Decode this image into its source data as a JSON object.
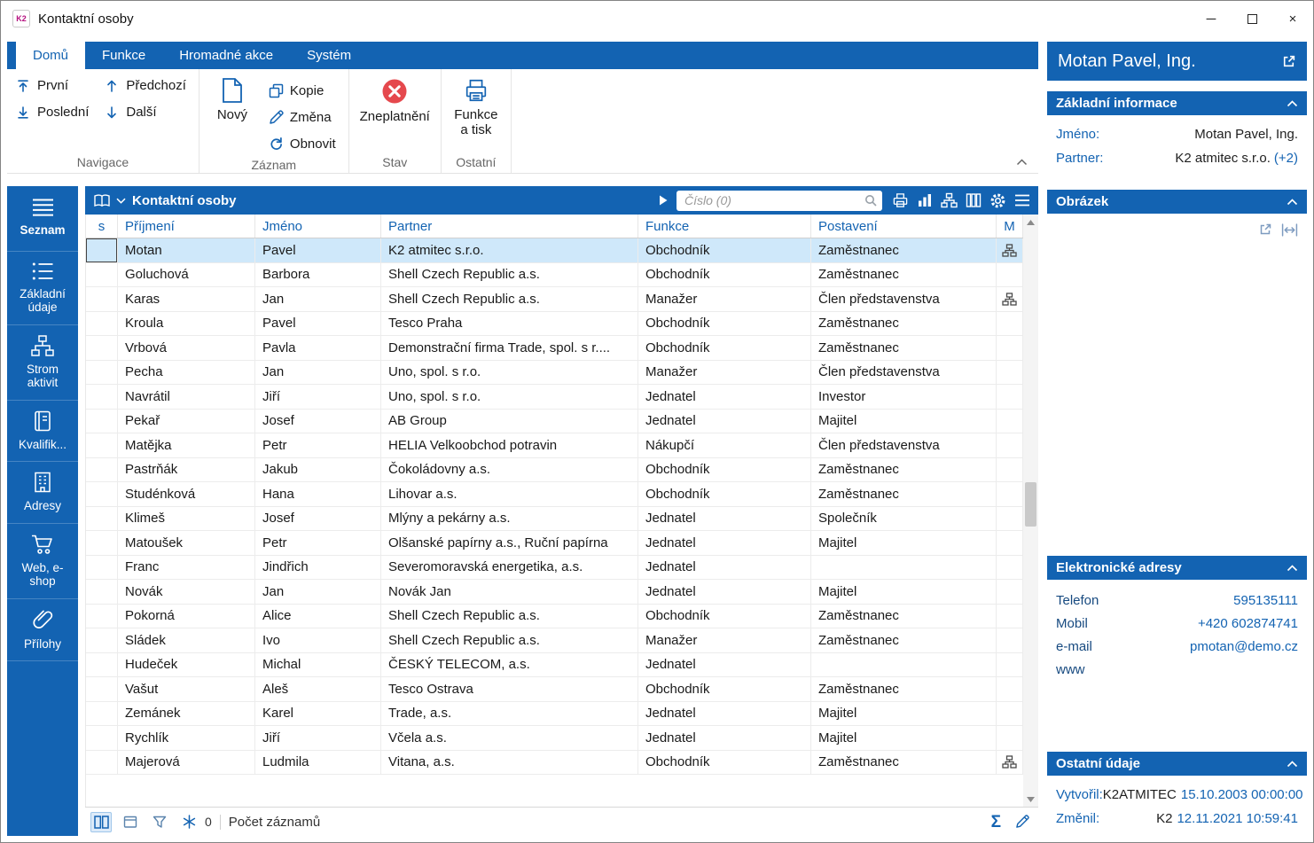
{
  "window": {
    "logo": "K2",
    "title": "Kontaktní osoby",
    "minimize_glyph": "─",
    "close_glyph": "×"
  },
  "icons": {
    "sum": "Σ"
  },
  "ribbon": {
    "tabs": [
      {
        "label": "Domů",
        "active": true
      },
      {
        "label": "Funkce",
        "active": false
      },
      {
        "label": "Hromadné akce",
        "active": false
      },
      {
        "label": "Systém",
        "active": false
      }
    ],
    "navigace": {
      "label": "Navigace",
      "items": [
        {
          "label": "První"
        },
        {
          "label": "Předchozí"
        },
        {
          "label": "Poslední"
        },
        {
          "label": "Další"
        }
      ]
    },
    "zaznam": {
      "label": "Záznam",
      "new_label": "Nový",
      "items": [
        {
          "label": "Kopie"
        },
        {
          "label": "Změna"
        },
        {
          "label": "Obnovit"
        }
      ]
    },
    "stav": {
      "label": "Stav",
      "invalidate_label": "Zneplatnění"
    },
    "ostatni": {
      "label": "Ostatní",
      "print_label": "Funkce a tisk"
    }
  },
  "sidebar": {
    "items": [
      {
        "label": "Seznam"
      },
      {
        "label": "Základní údaje"
      },
      {
        "label": "Strom aktivit"
      },
      {
        "label": "Kvalifik..."
      },
      {
        "label": "Adresy"
      },
      {
        "label": "Web, e-shop"
      },
      {
        "label": "Přílohy"
      }
    ]
  },
  "grid": {
    "title": "Kontaktní osoby",
    "search_placeholder": "Číslo (0)",
    "columns": {
      "s": "s",
      "surname": "Příjmení",
      "name": "Jméno",
      "partner": "Partner",
      "role": "Funkce",
      "position": "Postavení",
      "m": "M"
    },
    "rows": [
      {
        "surname": "Motan",
        "name": "Pavel",
        "partner": "K2 atmitec s.r.o.",
        "role": "Obchodník",
        "position": "Zaměstnanec",
        "org": true,
        "selected": true
      },
      {
        "surname": "Goluchová",
        "name": "Barbora",
        "partner": "Shell Czech Republic a.s.",
        "role": "Obchodník",
        "position": "Zaměstnanec"
      },
      {
        "surname": "Karas",
        "name": "Jan",
        "partner": "Shell Czech Republic a.s.",
        "role": "Manažer",
        "position": "Člen představenstva",
        "org": true
      },
      {
        "surname": "Kroula",
        "name": "Pavel",
        "partner": "Tesco Praha",
        "role": "Obchodník",
        "position": "Zaměstnanec"
      },
      {
        "surname": "Vrbová",
        "name": "Pavla",
        "partner": "Demonstrační firma Trade, spol. s r....",
        "role": "Obchodník",
        "position": "Zaměstnanec"
      },
      {
        "surname": "Pecha",
        "name": "Jan",
        "partner": "Uno, spol. s r.o.",
        "role": "Manažer",
        "position": "Člen představenstva"
      },
      {
        "surname": "Navrátil",
        "name": "Jiří",
        "partner": "Uno, spol. s r.o.",
        "role": "Jednatel",
        "position": "Investor"
      },
      {
        "surname": "Pekař",
        "name": "Josef",
        "partner": "AB Group",
        "role": "Jednatel",
        "position": "Majitel"
      },
      {
        "surname": "Matějka",
        "name": "Petr",
        "partner": "HELIA Velkoobchod potravin",
        "role": "Nákupčí",
        "position": "Člen představenstva"
      },
      {
        "surname": "Pastrňák",
        "name": "Jakub",
        "partner": "Čokoládovny a.s.",
        "role": "Obchodník",
        "position": "Zaměstnanec"
      },
      {
        "surname": "Studénková",
        "name": "Hana",
        "partner": "Lihovar a.s.",
        "role": "Obchodník",
        "position": "Zaměstnanec"
      },
      {
        "surname": "Klimeš",
        "name": "Josef",
        "partner": "Mlýny a pekárny a.s.",
        "role": "Jednatel",
        "position": "Společník"
      },
      {
        "surname": "Matoušek",
        "name": "Petr",
        "partner": "Olšanské papírny a.s., Ruční papírna",
        "role": "Jednatel",
        "position": "Majitel"
      },
      {
        "surname": "Franc",
        "name": "Jindřich",
        "partner": "Severomoravská energetika, a.s.",
        "role": "Jednatel",
        "position": ""
      },
      {
        "surname": "Novák",
        "name": "Jan",
        "partner": "Novák Jan",
        "role": "Jednatel",
        "position": "Majitel"
      },
      {
        "surname": "Pokorná",
        "name": "Alice",
        "partner": "Shell Czech Republic a.s.",
        "role": "Obchodník",
        "position": "Zaměstnanec"
      },
      {
        "surname": "Sládek",
        "name": "Ivo",
        "partner": "Shell Czech Republic a.s.",
        "role": "Manažer",
        "position": "Zaměstnanec"
      },
      {
        "surname": "Hudeček",
        "name": "Michal",
        "partner": "ČESKÝ TELECOM, a.s.",
        "role": "Jednatel",
        "position": ""
      },
      {
        "surname": "Vašut",
        "name": "Aleš",
        "partner": "Tesco Ostrava",
        "role": "Obchodník",
        "position": "Zaměstnanec"
      },
      {
        "surname": "Zemánek",
        "name": "Karel",
        "partner": "Trade, a.s.",
        "role": "Jednatel",
        "position": "Majitel"
      },
      {
        "surname": "Rychlík",
        "name": "Jiří",
        "partner": "Včela a.s.",
        "role": "Jednatel",
        "position": "Majitel"
      },
      {
        "surname": "Majerová",
        "name": "Ludmila",
        "partner": "Vitana, a.s.",
        "role": "Obchodník",
        "position": "Zaměstnanec",
        "org": true
      }
    ],
    "status": {
      "frozen_count": "0",
      "records_label": "Počet záznamů"
    }
  },
  "detail": {
    "title": "Motan Pavel, Ing.",
    "basic": {
      "title": "Základní informace",
      "name_label": "Jméno:",
      "name_value": "Motan Pavel, Ing.",
      "partner_label": "Partner:",
      "partner_value": "K2 atmitec s.r.o.",
      "partner_extra": "(+2)"
    },
    "picture": {
      "title": "Obrázek"
    },
    "eaddresses": {
      "title": "Elektronické adresy",
      "rows": [
        {
          "label": "Telefon",
          "value": "595135111"
        },
        {
          "label": "Mobil",
          "value": "+420 602874741"
        },
        {
          "label": "e-mail",
          "value": "pmotan@demo.cz"
        },
        {
          "label": "www",
          "value": ""
        }
      ]
    },
    "other": {
      "title": "Ostatní údaje",
      "rows": [
        {
          "label": "Vytvořil:",
          "user": "K2ATMITEC",
          "timestamp": "15.10.2003 00:00:00"
        },
        {
          "label": "Změnil:",
          "user": "K2",
          "timestamp": "12.11.2021 10:59:41"
        }
      ]
    }
  }
}
